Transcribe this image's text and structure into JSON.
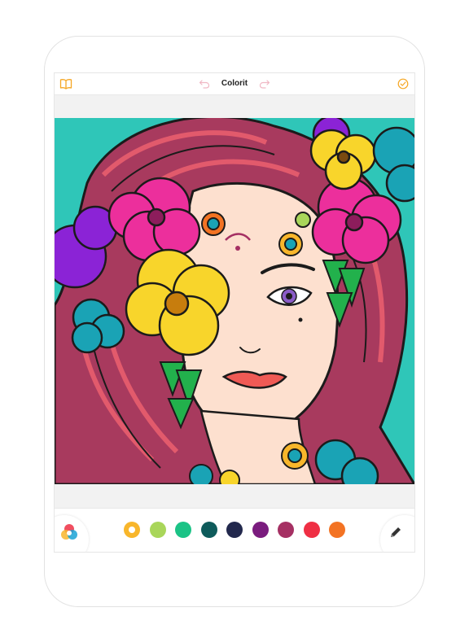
{
  "app": {
    "title": "Colorit"
  },
  "icons": {
    "library": "book-icon",
    "undo": "undo-icon",
    "redo": "redo-icon",
    "done": "check-circle-icon",
    "palette": "color-palette-icon",
    "tool": "pencil-icon"
  },
  "colors": {
    "accent": "#f5a623",
    "undo_disabled": "#f0b8c4",
    "background": "#2fc6b8"
  },
  "palette": [
    {
      "name": "yellow",
      "color": "#f8b62b",
      "selected": true
    },
    {
      "name": "lime",
      "color": "#a9d65a",
      "selected": false
    },
    {
      "name": "emerald",
      "color": "#1bc386",
      "selected": false
    },
    {
      "name": "dark-teal",
      "color": "#0e5b5b",
      "selected": false
    },
    {
      "name": "navy",
      "color": "#22284d",
      "selected": false
    },
    {
      "name": "purple",
      "color": "#7a1c7e",
      "selected": false
    },
    {
      "name": "plum",
      "color": "#a53063",
      "selected": false
    },
    {
      "name": "red",
      "color": "#ef2f44",
      "selected": false
    },
    {
      "name": "orange",
      "color": "#f37323",
      "selected": false
    }
  ]
}
